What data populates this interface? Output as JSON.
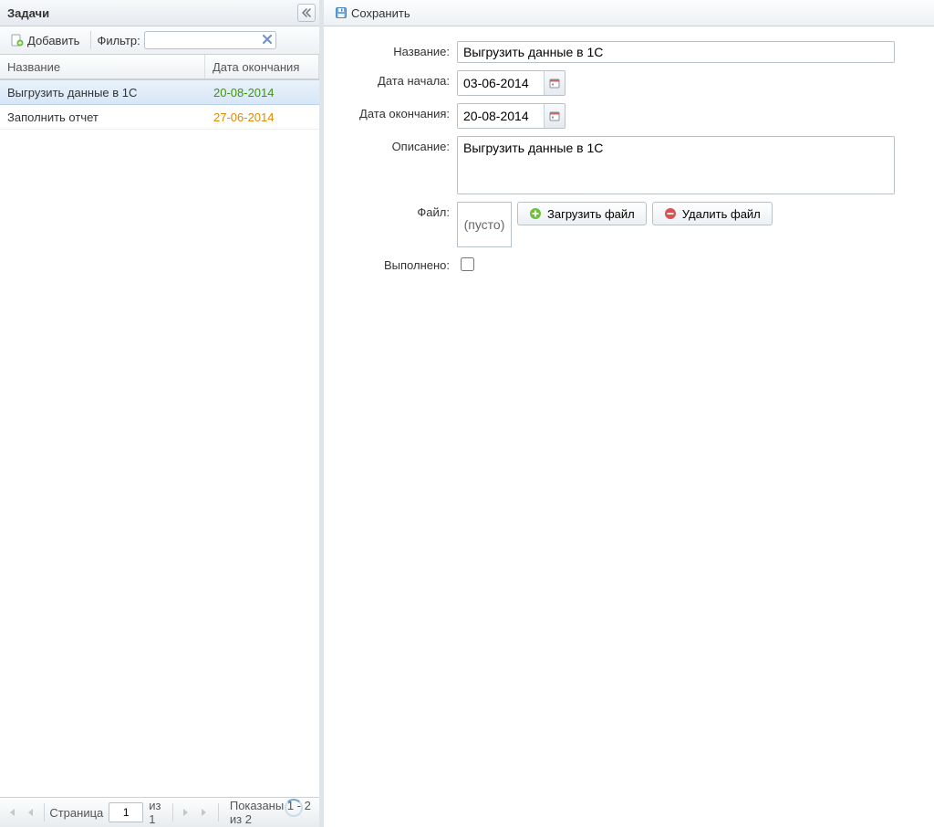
{
  "left": {
    "title": "Задачи",
    "add_label": "Добавить",
    "filter_label": "Фильтр:",
    "filter_value": "",
    "columns": {
      "title": "Название",
      "end_date": "Дата окончания"
    },
    "rows": [
      {
        "title": "Выгрузить данные в 1С",
        "end_date": "20-08-2014",
        "date_class": "date-green",
        "selected": true
      },
      {
        "title": "Заполнить отчет",
        "end_date": "27-06-2014",
        "date_class": "date-orange",
        "selected": false
      }
    ],
    "paging": {
      "page_label": "Страница",
      "page_value": "1",
      "of_label": "из 1",
      "status": "Показаны 1 - 2 из 2"
    }
  },
  "right": {
    "save_label": "Сохранить",
    "fields": {
      "name_label": "Название:",
      "name_value": "Выгрузить данные в 1С",
      "start_label": "Дата начала:",
      "start_value": "03-06-2014",
      "end_label": "Дата окончания:",
      "end_value": "20-08-2014",
      "desc_label": "Описание:",
      "desc_value": "Выгрузить данные в 1С",
      "file_label": "Файл:",
      "file_value": "(пусто)",
      "upload_label": "Загрузить файл",
      "delete_label": "Удалить файл",
      "done_label": "Выполнено:",
      "done_checked": false
    }
  }
}
